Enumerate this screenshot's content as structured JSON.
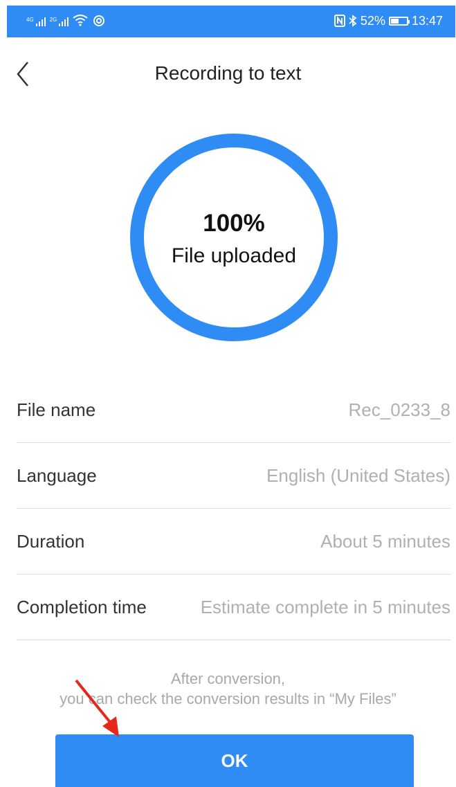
{
  "status_bar": {
    "network_1": "4G",
    "network_2": "2G",
    "battery": "52%",
    "battery_level": 0.52,
    "time": "13:47",
    "icons": [
      "signal-icon",
      "wifi-icon",
      "hotspot-icon",
      "nfc-icon",
      "bluetooth-icon",
      "battery-icon"
    ]
  },
  "header": {
    "title": "Recording to text",
    "back_icon": "chevron-left-icon"
  },
  "progress": {
    "percent_label": "100%",
    "status": "File uploaded",
    "value": 1.0,
    "color": "#2f8cf5"
  },
  "details": [
    {
      "label": "File name",
      "value": "Rec_0233_8"
    },
    {
      "label": "Language",
      "value": "English (United States)"
    },
    {
      "label": "Duration",
      "value": "About 5 minutes"
    },
    {
      "label": "Completion time",
      "value": "Estimate complete in 5 minutes"
    }
  ],
  "note": {
    "line1": "After conversion,",
    "line2": "you can check the conversion results in “My Files”"
  },
  "ok_button": {
    "label": "OK"
  },
  "colors": {
    "accent": "#2f8cf5",
    "annotation": "#e8271b"
  }
}
